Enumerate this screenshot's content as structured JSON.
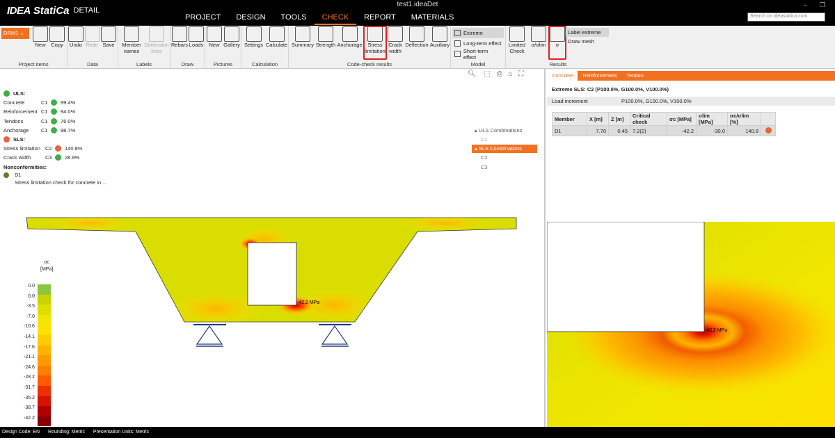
{
  "app": {
    "window_title": "test1.ideaDet",
    "logo_main": "IDEA",
    "logo_brand": "StatiCa",
    "logo_product": "DETAIL",
    "search_placeholder": "Search on ideastatica.com"
  },
  "menu": [
    {
      "label": "PROJECT"
    },
    {
      "label": "DESIGN"
    },
    {
      "label": "TOOLS"
    },
    {
      "label": "CHECK",
      "active": true
    },
    {
      "label": "REPORT"
    },
    {
      "label": "MATERIALS"
    }
  ],
  "ribbon": {
    "member_dropdown": "DRM1",
    "groups": {
      "project_items": "Project items",
      "data": "Data",
      "labels": "Labels",
      "draw": "Draw",
      "pictures": "Pictures",
      "calculation": "Calculation",
      "code_check": "Code-check results",
      "model": "Model",
      "results": "Results"
    },
    "buttons": {
      "new": "New",
      "copy": "Copy",
      "undo": "Undo",
      "redo": "Redo",
      "save": "Save",
      "member_names": "Member names",
      "dimension_lines": "Dimension lines",
      "rebars": "Rebars",
      "loads": "Loads",
      "new_picture": "New",
      "gallery": "Gallery",
      "settings": "Settings",
      "calculate": "Calculate",
      "summary": "Summary",
      "strength": "Strength",
      "anchorage": "Anchorage",
      "stress_limitation": "Stress limitation",
      "crack_width": "Crack width",
      "deflection": "Deflection",
      "auxiliary": "Auxiliary",
      "limited_check": "Limited Check",
      "sigma_lim": "σ/σlim",
      "sigma": "σ"
    },
    "model_options": {
      "extreme": "Extreme",
      "long_term": "Long-term effect",
      "short_term": "Short-term effect"
    },
    "results_options": {
      "label_extreme": "Label extreme",
      "draw_mesh": "Draw mesh"
    }
  },
  "results": {
    "uls_title": "ULS:",
    "uls": [
      {
        "name": "Concrete",
        "combo": "C1",
        "value": "99.4%"
      },
      {
        "name": "Reinforcement",
        "combo": "C1",
        "value": "94.0%"
      },
      {
        "name": "Tendons",
        "combo": "C1",
        "value": "76.0%"
      },
      {
        "name": "Anchorage",
        "combo": "C1",
        "value": "98.7%"
      }
    ],
    "sls_title": "SLS:",
    "sls": [
      {
        "name": "Stress limitation",
        "combo": "C2",
        "value": "140.8%",
        "fail": true
      },
      {
        "name": "Crack width",
        "combo": "C3",
        "value": "28.9%"
      }
    ],
    "nonconformities_title": "Nonconformities:",
    "nonconformity_id": "D1",
    "nonconformity_text": "Stress limitation check for concrete in ..."
  },
  "combinations": {
    "uls_header": "ULS Combinations",
    "uls_items": [
      "C1"
    ],
    "sls_header": "SLS Combinations",
    "sls_items": [
      "C2",
      "C3"
    ]
  },
  "legend": {
    "symbol": "σc",
    "unit": "[MPa]",
    "labels": [
      "0.0",
      "0.0",
      "-3.5",
      "-7.0",
      "-10.6",
      "-14.1",
      "-17.6",
      "-21.1",
      "-24.6",
      "-28.2",
      "-31.7",
      "-35.2",
      "-38.7",
      "-42.2"
    ],
    "colors": [
      "#8cc63f",
      "#c9d400",
      "#dde000",
      "#f0e600",
      "#ffe000",
      "#ffcc00",
      "#ffb300",
      "#ff9900",
      "#ff7f00",
      "#ff5a00",
      "#f02e00",
      "#d81000",
      "#b00000",
      "#8a0000"
    ]
  },
  "section_label": "-42.2 MPa",
  "right": {
    "tabs": [
      "Concrete",
      "Reinforcement",
      "Tendon"
    ],
    "title": "Extreme SLS: C2 (P100.0%, G100.0%, V100.0%)",
    "load_increment_label": "Load increment",
    "load_increment_value": "P100.0%, G100.0%, V100.0%",
    "table": {
      "headers": [
        "Member",
        "X [m]",
        "Z [m]",
        "Critical check",
        "σc [MPa]",
        "σlim [MPa]",
        "σc/σlim [%]",
        ""
      ],
      "rows": [
        [
          "D1",
          "7.70",
          "0.45",
          "7.2(2)",
          "-42.2",
          "-30.0",
          "140.8"
        ]
      ]
    },
    "zoom_label": "-42.2 MPa"
  },
  "status": {
    "design_code": "Design Code: EN",
    "rounding": "Rounding: Metric",
    "units": "Presentation Units: Metric"
  }
}
